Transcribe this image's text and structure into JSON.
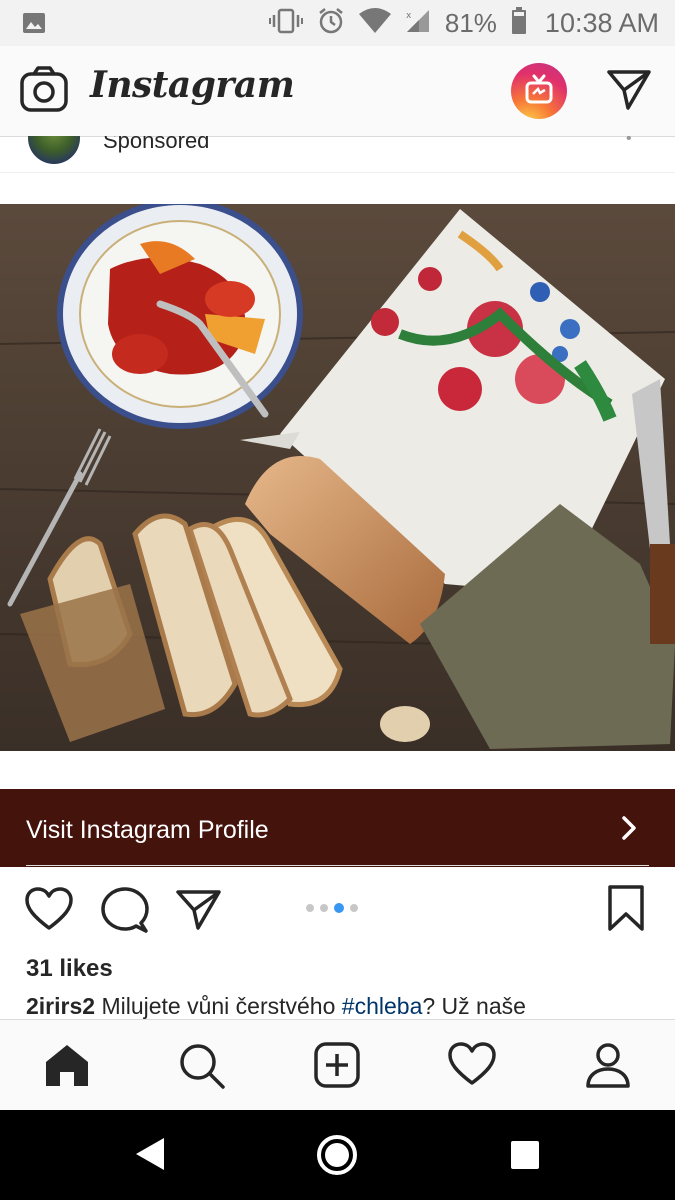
{
  "status_bar": {
    "battery": "81%",
    "time": "10:38 AM"
  },
  "header": {
    "logo": "Instagram"
  },
  "post": {
    "sponsored_label": "Sponsored",
    "cta_label": "Visit Instagram Profile",
    "likes": "31 likes",
    "username": "2irirs2",
    "caption_pre": " Milujete vůni čerstvého ",
    "hashtag": "#chleba",
    "caption_post": "? Už naše",
    "carousel": {
      "count": 4,
      "active_index": 2
    }
  },
  "colors": {
    "cta_background": "#43130c",
    "carousel_active": "#3897f0",
    "hashtag": "#003569"
  }
}
